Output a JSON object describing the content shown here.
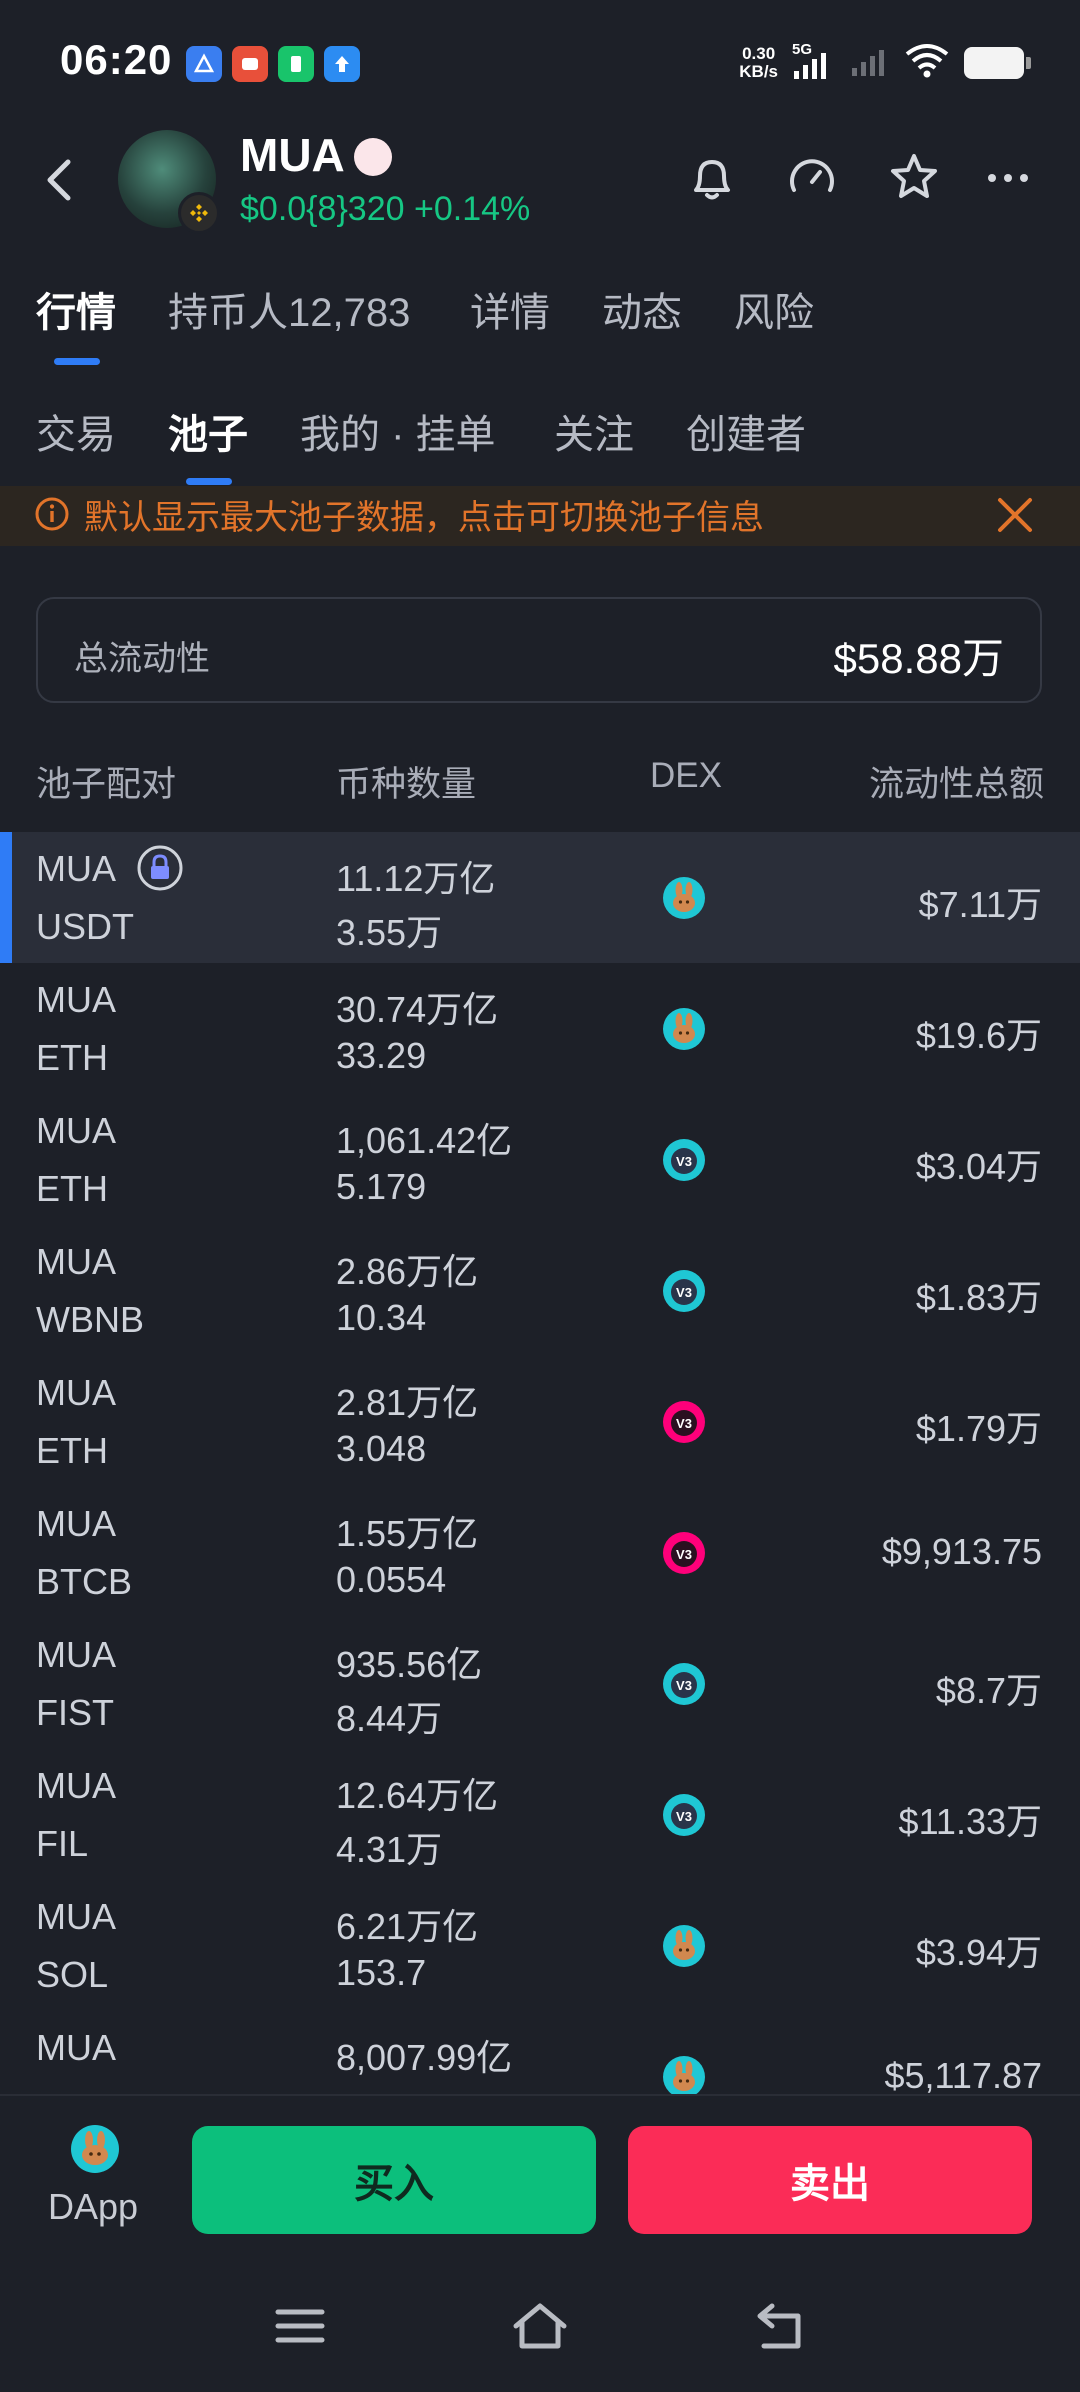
{
  "status_bar": {
    "time": "06:20",
    "net_speed_value": "0.30",
    "net_speed_unit": "KB/s",
    "network": "5G"
  },
  "header": {
    "token_name": "MUA",
    "price": "$0.0{8}320",
    "change": "+0.14%",
    "price_color": "#16c784"
  },
  "tabs_primary": [
    {
      "label": "行情"
    },
    {
      "label": "持币人12,783"
    },
    {
      "label": "详情"
    },
    {
      "label": "动态"
    },
    {
      "label": "风险"
    }
  ],
  "tabs_secondary": [
    {
      "label": "交易"
    },
    {
      "label": "池子"
    },
    {
      "label": "我的 · 挂单"
    },
    {
      "label": "关注"
    },
    {
      "label": "创建者"
    }
  ],
  "notice": {
    "text": "默认显示最大池子数据，点击可切换池子信息"
  },
  "total_liquidity": {
    "label": "总流动性",
    "value": "$58.88万"
  },
  "table": {
    "headers": [
      "池子配对",
      "币种数量",
      "DEX",
      "流动性总额"
    ],
    "rows": [
      {
        "base": "MUA",
        "quote": "USDT",
        "amt_base": "11.12万亿",
        "amt_quote": "3.55万",
        "dex": "pancake-icon",
        "liquidity": "$7.11万",
        "locked": true
      },
      {
        "base": "MUA",
        "quote": "ETH",
        "amt_base": "30.74万亿",
        "amt_quote": "33.29",
        "dex": "pancake-icon",
        "liquidity": "$19.6万",
        "locked": false
      },
      {
        "base": "MUA",
        "quote": "ETH",
        "amt_base": "1,061.42亿",
        "amt_quote": "5.179",
        "dex": "pancake-v3-icon",
        "liquidity": "$3.04万",
        "locked": false
      },
      {
        "base": "MUA",
        "quote": "WBNB",
        "amt_base": "2.86万亿",
        "amt_quote": "10.34",
        "dex": "pancake-v3-icon",
        "liquidity": "$1.83万",
        "locked": false
      },
      {
        "base": "MUA",
        "quote": "ETH",
        "amt_base": "2.81万亿",
        "amt_quote": "3.048",
        "dex": "uniswap-v3-icon",
        "liquidity": "$1.79万",
        "locked": false
      },
      {
        "base": "MUA",
        "quote": "BTCB",
        "amt_base": "1.55万亿",
        "amt_quote": "0.0554",
        "dex": "uniswap-v3-icon",
        "liquidity": "$9,913.75",
        "locked": false
      },
      {
        "base": "MUA",
        "quote": "FIST",
        "amt_base": "935.56亿",
        "amt_quote": "8.44万",
        "dex": "pancake-v3-icon",
        "liquidity": "$8.7万",
        "locked": false
      },
      {
        "base": "MUA",
        "quote": "FIL",
        "amt_base": "12.64万亿",
        "amt_quote": "4.31万",
        "dex": "pancake-v3-icon",
        "liquidity": "$11.33万",
        "locked": false
      },
      {
        "base": "MUA",
        "quote": "SOL",
        "amt_base": "6.21万亿",
        "amt_quote": "153.7",
        "dex": "pancake-icon",
        "liquidity": "$3.94万",
        "locked": false
      },
      {
        "base": "MUA",
        "quote": "",
        "amt_base": "8,007.99亿",
        "amt_quote": "",
        "dex": "pancake-icon",
        "liquidity": "$5,117.87",
        "locked": false
      }
    ]
  },
  "bottom": {
    "dapp_label": "DApp",
    "buy_label": "买入",
    "sell_label": "卖出",
    "buy_color": "#0cbf7c",
    "sell_color": "#fb2c57"
  },
  "colors": {
    "background": "#1d2028",
    "accent": "#2f7cf6",
    "notice_text": "#e2742a"
  }
}
